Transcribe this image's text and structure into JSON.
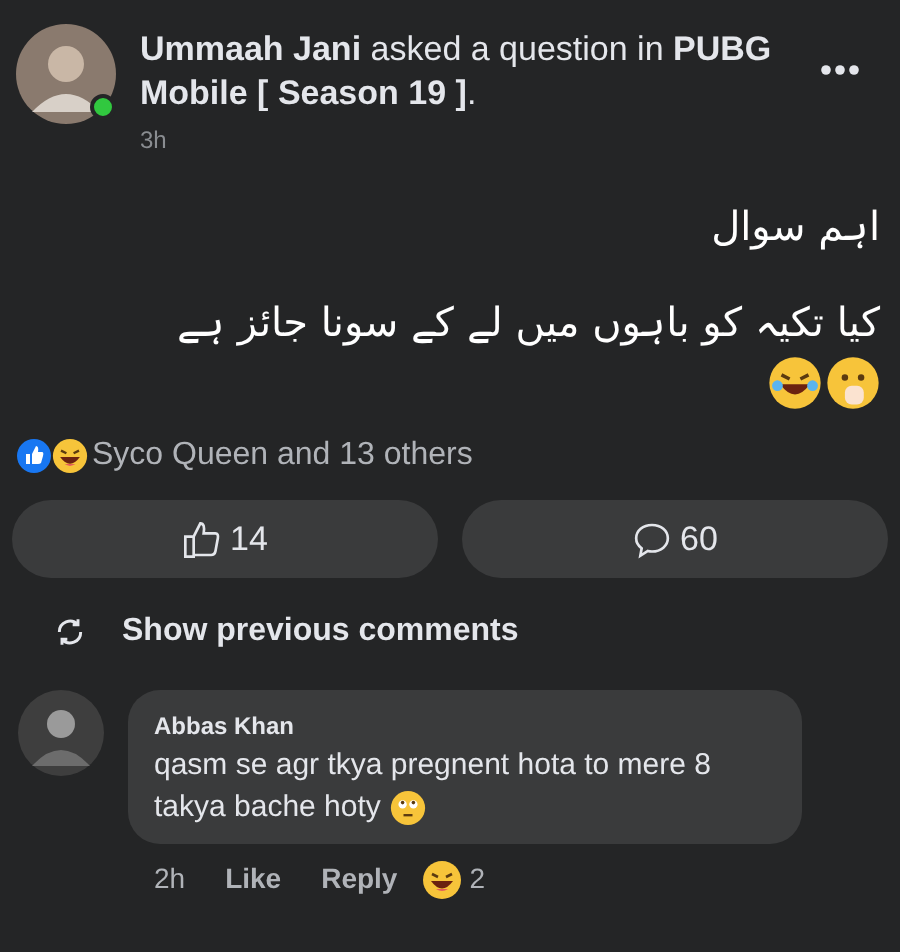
{
  "post": {
    "author": "Ummaah Jani",
    "action": "asked a question in",
    "group": "PUBG Mobile [ Season 19 ]",
    "suffix": ".",
    "time": "3h",
    "online": true,
    "question_lines": [
      "اہم سوال",
      "کیا تکیہ کو باہوں میں لے کے سونا جائز ہے"
    ]
  },
  "reactions": {
    "summary": "Syco Queen and 13 others"
  },
  "actions": [
    {
      "kind": "like",
      "label": "14"
    },
    {
      "kind": "comment",
      "label": "60"
    }
  ],
  "show_previous": "Show previous comments",
  "comments": [
    {
      "author": "Abbas Khan",
      "text": "qasm se agr tkya pregnent hota to mere 8 takya bache hoty",
      "time": "2h",
      "like": "Like",
      "reply": "Reply",
      "reaction_count": "2"
    }
  ]
}
